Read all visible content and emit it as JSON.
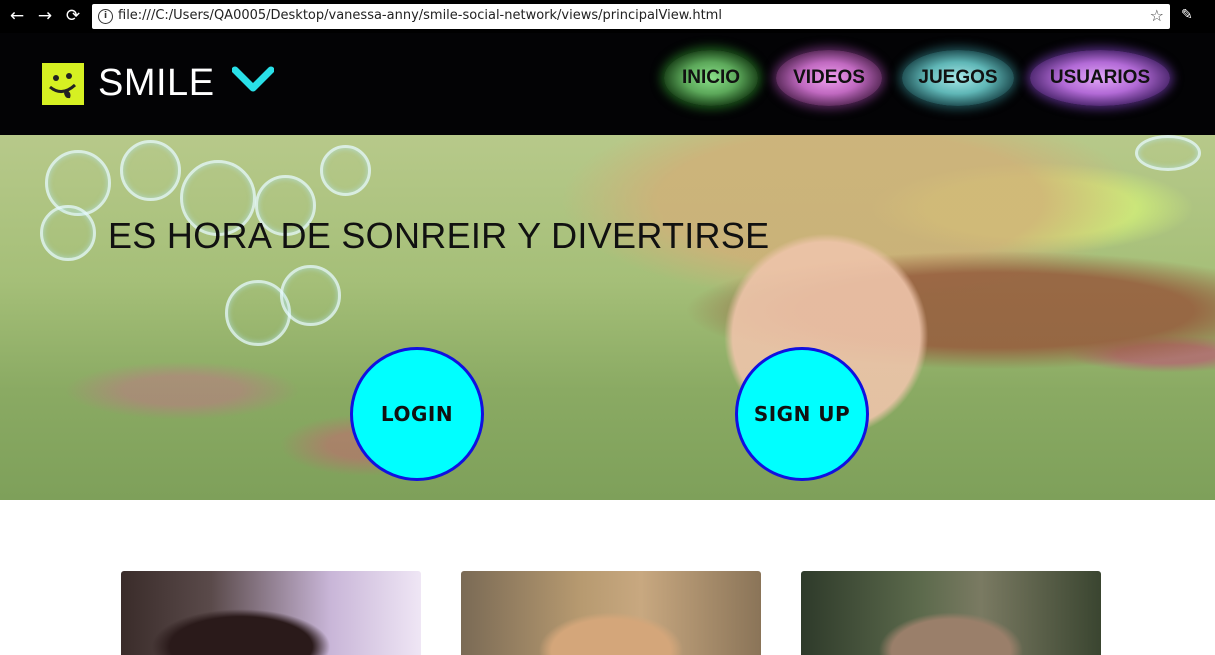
{
  "browser": {
    "url": "file:///C:/Users/QA0005/Desktop/vanessa-anny/smile-social-network/views/principalView.html",
    "back_icon": "←",
    "forward_icon": "→",
    "reload_icon": "⟳",
    "info_icon": "i",
    "star_icon": "☆",
    "ext_icon": "✎"
  },
  "header": {
    "brand": "SMILE",
    "nav": {
      "inicio": "INICIO",
      "videos": "VIDEOS",
      "juegos": "JUEGOS",
      "usuarios": "USUARIOS"
    }
  },
  "hero": {
    "title": "ES HORA DE SONREIR Y DIVERTIRSE",
    "login": "LOGIN",
    "signup": "SIGN UP"
  },
  "colors": {
    "header_bg": "#030305",
    "logo_bg": "#d6f022",
    "chevron": "#29e0e8",
    "button_fill": "#00ffff",
    "button_border": "#1010e0"
  }
}
